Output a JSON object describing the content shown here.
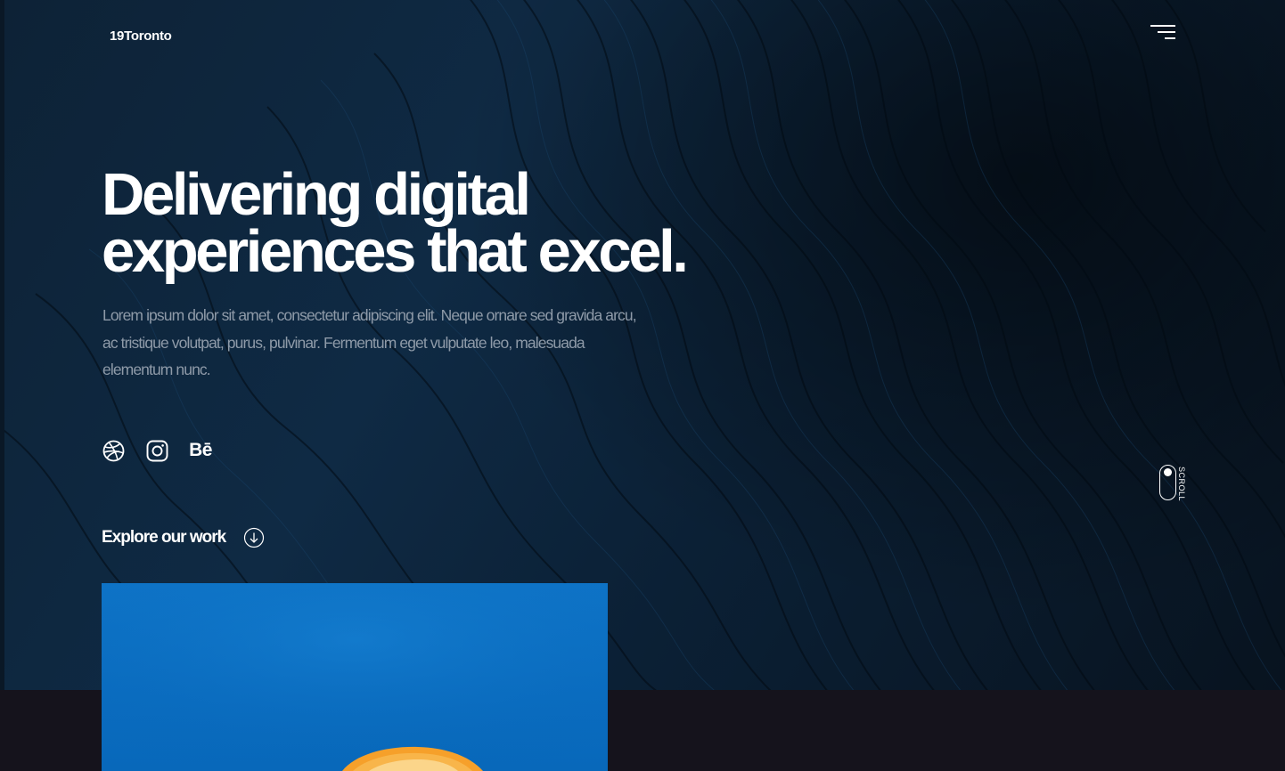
{
  "brand": {
    "logo": "19Toronto"
  },
  "menu": {
    "icon": "hamburger-menu-icon"
  },
  "hero": {
    "headline_line1": "Delivering digital",
    "headline_line2": "experiences that excel.",
    "lead": "Lorem ipsum dolor sit amet, consectetur adipiscing elit. Neque ornare sed gravida arcu, ac tristique volutpat, purus, pulvinar. Fermentum eget vulputate leo, malesuada elementum nunc."
  },
  "socials": [
    {
      "icon": "dribbble-icon"
    },
    {
      "icon": "instagram-icon"
    },
    {
      "icon": "behance-icon",
      "text": "Bē"
    }
  ],
  "cta": {
    "label": "Explore our work",
    "icon": "arrow-down-circle-icon"
  },
  "scroll": {
    "label": "SCROLL"
  },
  "colors": {
    "hero_bg": "#0f2a44",
    "page_bg": "#15131c",
    "feature_blue": "#0a6cc0",
    "orange": "#f6a02a"
  }
}
